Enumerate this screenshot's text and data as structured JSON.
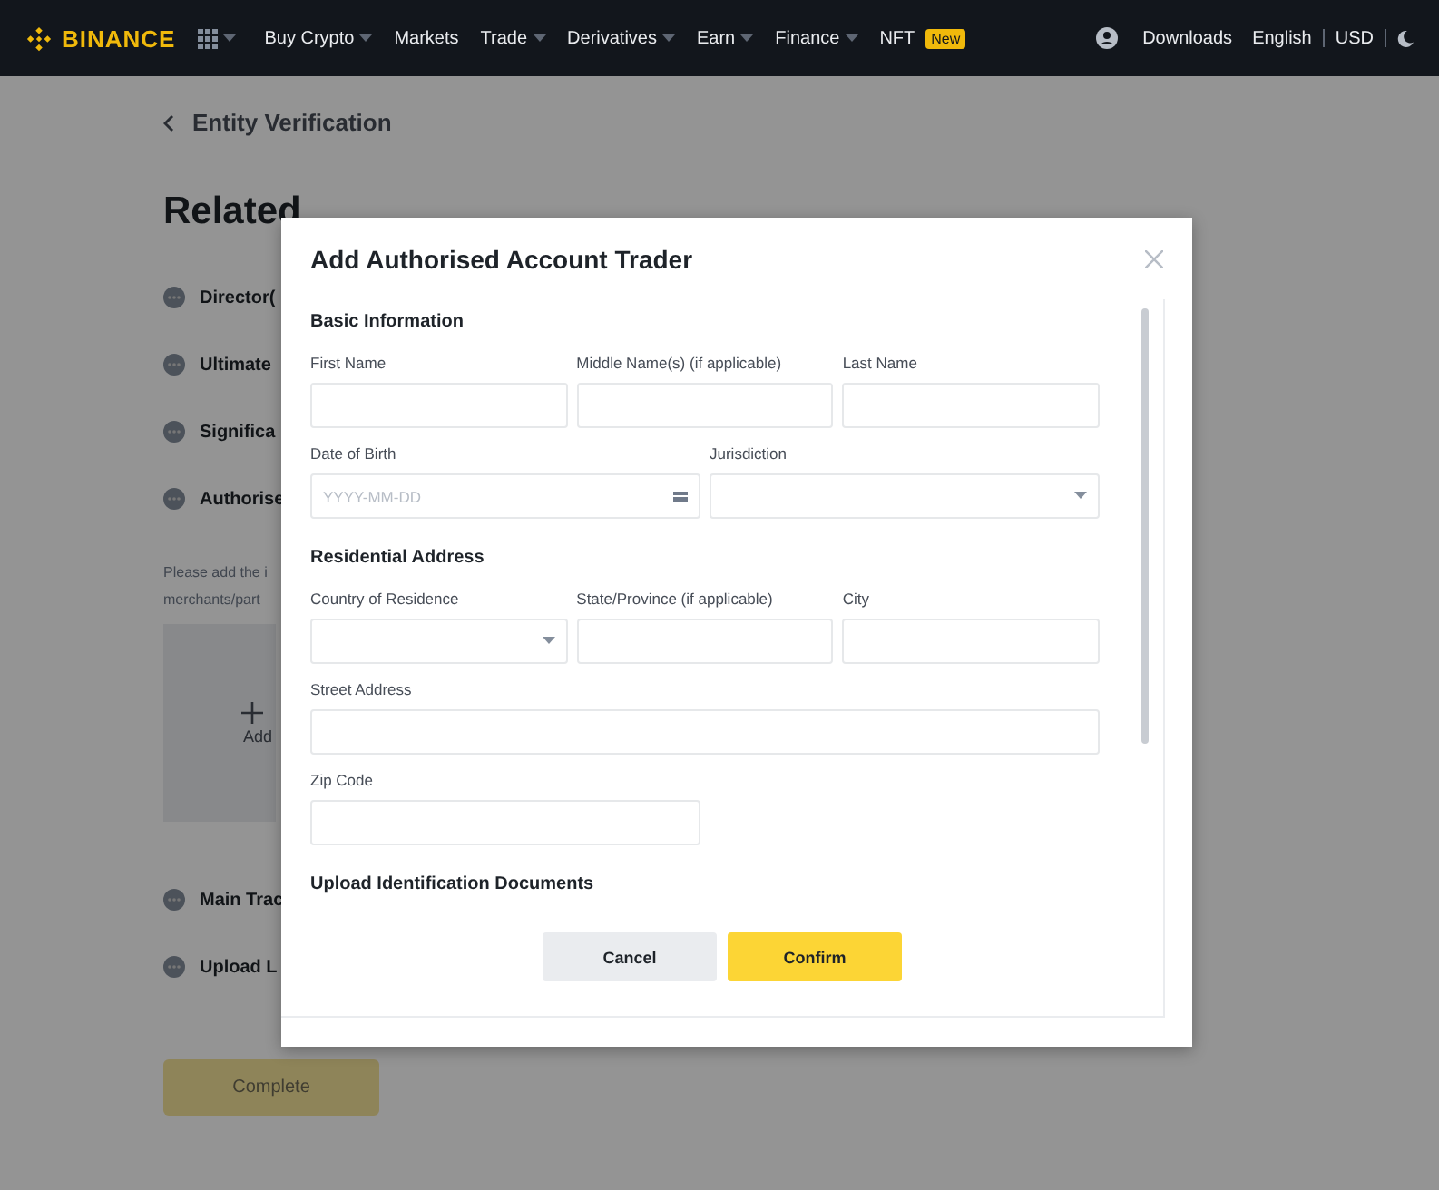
{
  "nav": {
    "logo": "BINANCE",
    "menu": [
      {
        "label": "Buy Crypto",
        "dropdown": true
      },
      {
        "label": "Markets",
        "dropdown": false
      },
      {
        "label": "Trade",
        "dropdown": true
      },
      {
        "label": "Derivatives",
        "dropdown": true
      },
      {
        "label": "Earn",
        "dropdown": true
      },
      {
        "label": "Finance",
        "dropdown": true
      },
      {
        "label": "NFT",
        "dropdown": false,
        "badge": "New"
      }
    ],
    "downloads": "Downloads",
    "language": "English",
    "currency": "USD"
  },
  "page": {
    "back": "Entity Verification",
    "heading": "Related",
    "steps": [
      "Director(",
      "Ultimate",
      "Significa",
      "Authorise"
    ],
    "note": [
      "Please add the i",
      "merchants/part"
    ],
    "add_card": {
      "label": "Add"
    },
    "steps_after": [
      "Main Trac",
      "Upload L"
    ],
    "complete_button": {
      "label": "Complete",
      "disabled": true
    }
  },
  "modal": {
    "title": "Add Authorised Account Trader",
    "sections": [
      {
        "title": "Basic Information",
        "rows": [
          [
            {
              "label": "First Name",
              "kind": "text"
            },
            {
              "label": "Middle Name(s) (if applicable)",
              "kind": "text"
            },
            {
              "label": "Last Name",
              "kind": "text"
            }
          ],
          [
            {
              "label": "Date of Birth",
              "kind": "date",
              "placeholder": "YYYY-MM-DD"
            },
            {
              "label": "Jurisdiction",
              "kind": "select"
            }
          ]
        ]
      },
      {
        "title": "Residential Address",
        "rows": [
          [
            {
              "label": "Country of Residence",
              "kind": "select"
            },
            {
              "label": "State/Province (if applicable)",
              "kind": "text"
            },
            {
              "label": "City",
              "kind": "text"
            }
          ],
          [
            {
              "label": "Street Address",
              "kind": "text",
              "full_width": true
            }
          ],
          [
            {
              "label": "Zip Code",
              "kind": "text"
            }
          ]
        ]
      },
      {
        "title": "Upload Identification Documents"
      }
    ],
    "buttons": [
      {
        "label": "Cancel",
        "kind": "secondary"
      },
      {
        "label": "Confirm",
        "kind": "primary"
      }
    ]
  }
}
